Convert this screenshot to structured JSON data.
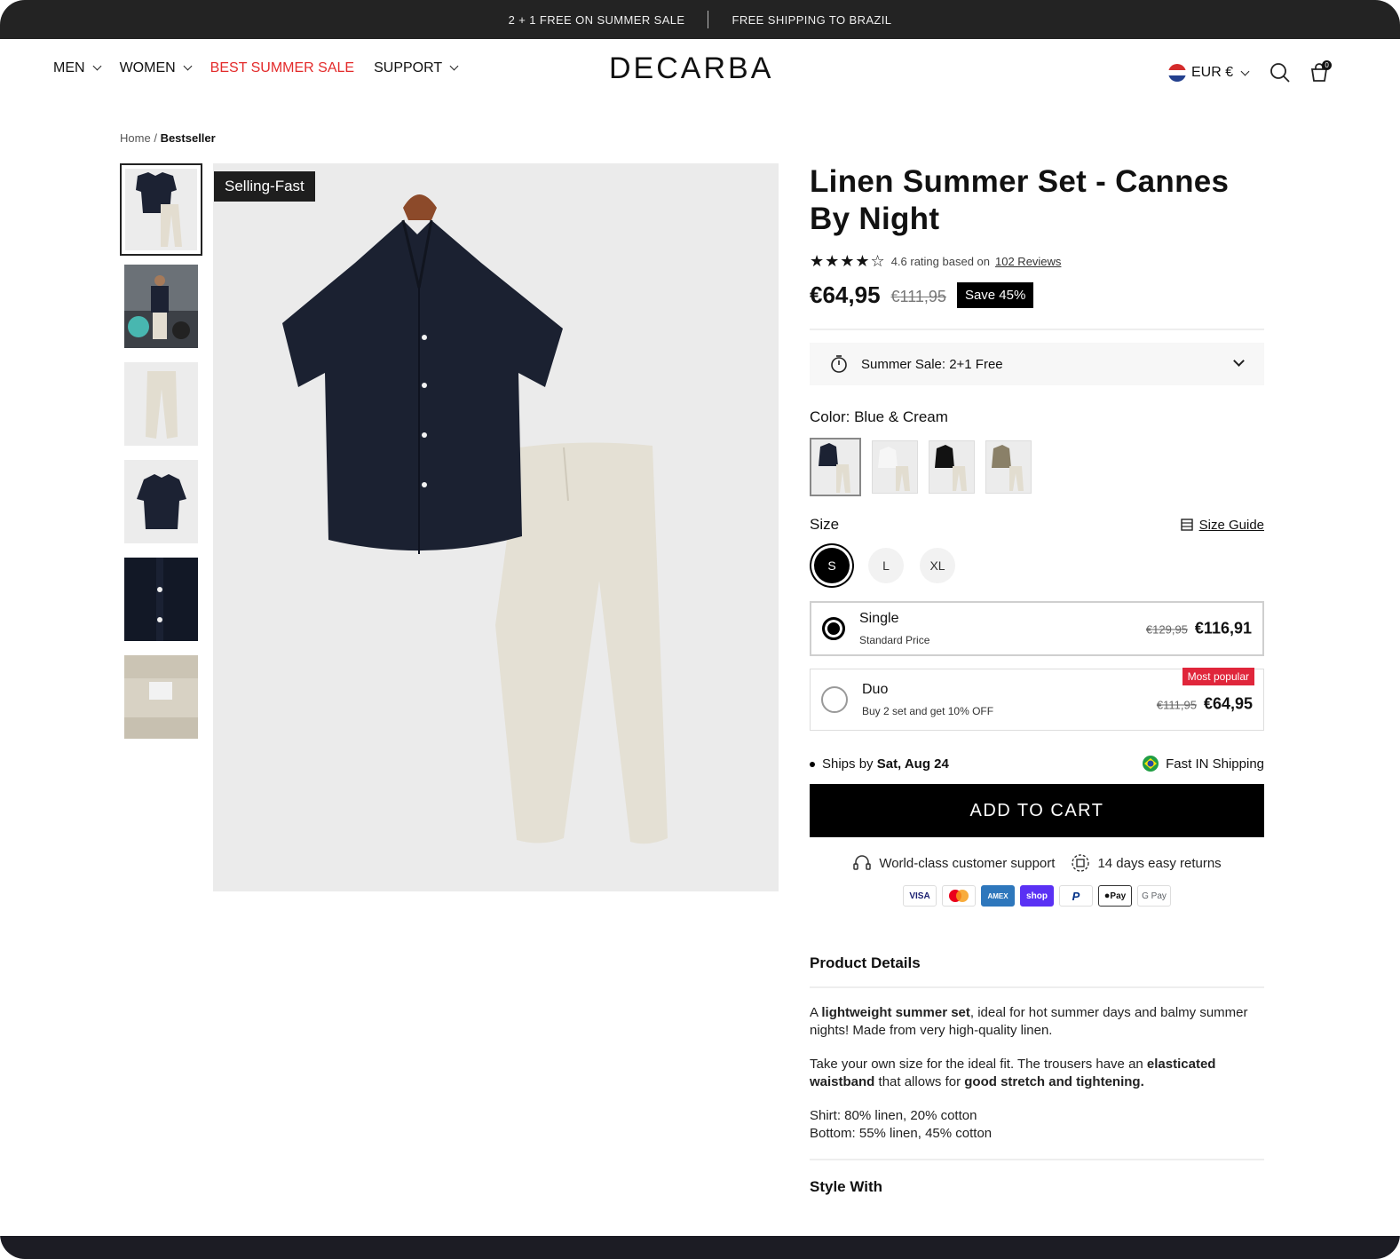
{
  "announcement": {
    "left": "2 + 1  FREE ON SUMMER SALE",
    "right": "FREE SHIPPING TO BRAZIL"
  },
  "nav": {
    "items": [
      {
        "label": "MEN",
        "dropdown": true
      },
      {
        "label": "WOMEN",
        "dropdown": true
      },
      {
        "label": "BEST SUMMER SALE",
        "dropdown": false
      },
      {
        "label": "SUPPORT",
        "dropdown": true
      }
    ],
    "sale_color": "#e32a2a"
  },
  "logo": "DECARBA",
  "header_right": {
    "currency": "EUR €",
    "icons": [
      "flag-icon",
      "search-icon",
      "cart-icon"
    ],
    "cart_count": "0"
  },
  "breadcrumb": {
    "home": "Home",
    "separator": "/",
    "current": "Bestseller"
  },
  "gallery": {
    "badge": "Selling-Fast",
    "thumbnail_count": 6
  },
  "product": {
    "title": "Linen Summer Set - Cannes By Night",
    "stars": "★★★★☆",
    "rating_text": "4.6 rating based on",
    "reviews_link": "102 Reviews",
    "price": "€64,95",
    "old_price": "€111,95",
    "save_badge": "Save 45%",
    "sale_accordion": "Summer Sale: 2+1 Free",
    "color_label": "Color:",
    "color_value": "Blue & Cream",
    "size_label": "Size",
    "size_guide": "Size Guide",
    "sizes": [
      "S",
      "L",
      "XL"
    ],
    "selected_size": "S",
    "options": {
      "single": {
        "name": "Single",
        "sub": "Standard Price",
        "old": "€129,95",
        "price": "€116,91"
      },
      "duo": {
        "name": "Duo",
        "sub": "Buy 2 set and get 10% OFF",
        "old": "€111,95",
        "price": "€64,95",
        "badge": "Most popular"
      }
    },
    "ships_prefix": "Ships by",
    "ships_date": "Sat, Aug 24",
    "fast_shipping": "Fast IN Shipping",
    "add_to_cart": "ADD TO CART",
    "perk_support": "World-class customer support",
    "perk_returns": "14 days easy returns",
    "payments": [
      "VISA",
      "",
      "AMEX",
      "shop",
      "P",
      "Pay",
      "G Pay"
    ],
    "accent": "#000000",
    "badge_red": "#e0263b"
  },
  "details": {
    "heading": "Product Details",
    "p1_a": "A ",
    "p1_b": "lightweight summer set",
    "p1_c": ", ideal for hot summer days and balmy summer nights! Made from very high-quality linen.",
    "p2_a": "Take your own size for the ideal fit. The trousers have an ",
    "p2_b": "elasticated waistband",
    "p2_c": " that allows for ",
    "p2_d": "good stretch and tightening.",
    "p3_line1": "Shirt: 80% linen, 20% cotton",
    "p3_line2": "Bottom: 55% linen, 45% cotton",
    "style_with": "Style With"
  }
}
